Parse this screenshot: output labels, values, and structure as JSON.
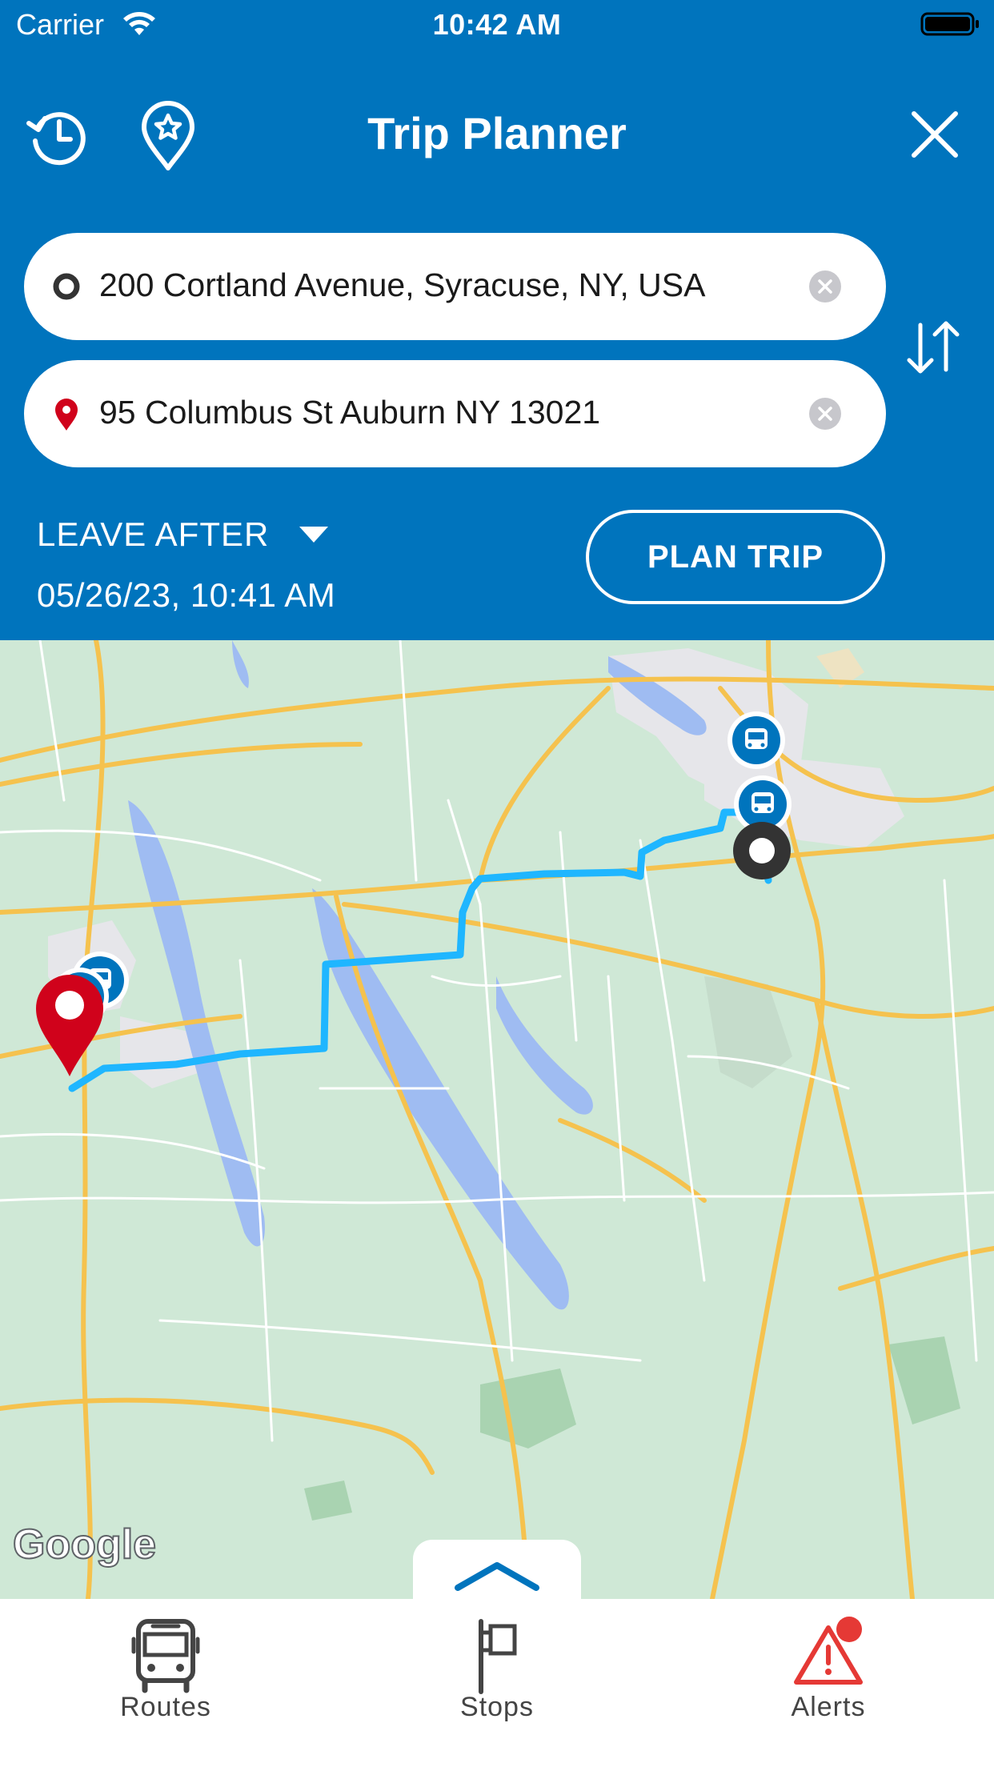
{
  "status_bar": {
    "carrier": "Carrier",
    "time": "10:42 AM"
  },
  "header": {
    "title": "Trip Planner",
    "icons": {
      "history": "history-icon",
      "favorites": "star-pin-icon",
      "close": "close-icon"
    }
  },
  "trip": {
    "origin": "200 Cortland Avenue, Syracuse, NY, USA",
    "destination": "95 Columbus St Auburn NY 13021",
    "leave_mode": "LEAVE AFTER",
    "datetime": "05/26/23, 10:41 AM",
    "plan_label": "PLAN TRIP"
  },
  "map": {
    "attribution": "Google",
    "route_color": "#1fb6ff",
    "stop_marker_color": "#0074bd",
    "destination_pin_color": "#d0021b"
  },
  "tabs": [
    {
      "label": "Routes",
      "icon": "bus-icon"
    },
    {
      "label": "Stops",
      "icon": "stop-sign-icon"
    },
    {
      "label": "Alerts",
      "icon": "alert-triangle-icon",
      "badge": true
    }
  ],
  "colors": {
    "brand_blue": "#0074bd",
    "alert_red": "#e53935"
  }
}
